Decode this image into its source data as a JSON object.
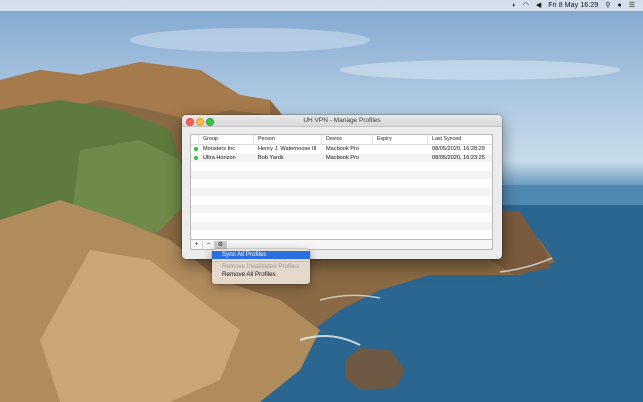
{
  "menubar": {
    "icons": [
      "vpn-icon",
      "wifi-icon",
      "volume-icon"
    ],
    "clock": "Fri 8 May  16:29",
    "right_icons": [
      "search-icon",
      "user-icon",
      "list-icon"
    ]
  },
  "window": {
    "title": "UH VPN - Manage Profiles",
    "table": {
      "headers": [
        "Group",
        "Person",
        "Device",
        "Expiry",
        "Last Synced"
      ],
      "rows": [
        {
          "status": "active",
          "group": "Monsters Inc",
          "person": "Henry J. Waternoose III",
          "device": "Macbook Pro",
          "expiry": "",
          "last_synced": "08/05/2020, 16:28:29"
        },
        {
          "status": "active",
          "group": "Ultra Horizon",
          "person": "Bob Yards",
          "device": "Macbook Pro",
          "expiry": "",
          "last_synced": "08/05/2020, 16:23:25"
        }
      ]
    },
    "bottom_buttons": {
      "add": "+",
      "remove": "−",
      "gear": "⚙"
    }
  },
  "context_menu": {
    "items": [
      {
        "label": "Sync All Profiles",
        "state": "highlighted"
      },
      {
        "label": "Remove Invalidated Profiles",
        "state": "disabled"
      },
      {
        "label": "Remove All Profiles",
        "state": "enabled"
      }
    ]
  },
  "colors": {
    "status_active": "#2fbd3c",
    "highlight": "#2a6ee0"
  }
}
